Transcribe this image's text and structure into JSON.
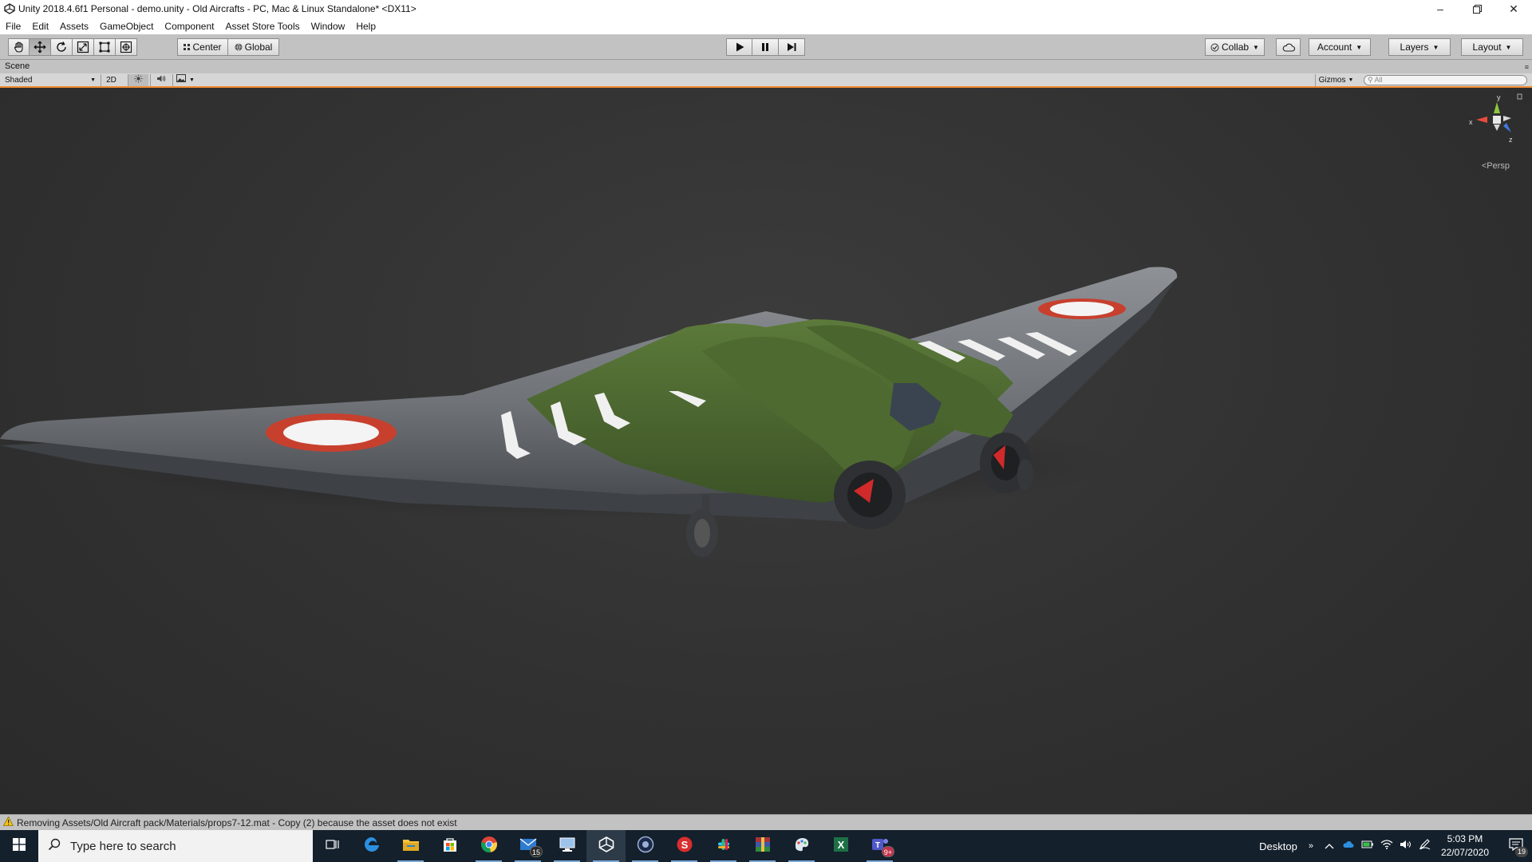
{
  "window": {
    "title": "Unity 2018.4.6f1 Personal - demo.unity - Old Aircrafts - PC, Mac & Linux Standalone* <DX11>"
  },
  "menu": [
    "File",
    "Edit",
    "Assets",
    "GameObject",
    "Component",
    "Asset Store Tools",
    "Window",
    "Help"
  ],
  "toolbar": {
    "transform_tools": [
      "hand-icon",
      "move-icon",
      "rotate-icon",
      "scale-icon",
      "rect-icon",
      "transform-icon"
    ],
    "active_tool": "move-icon",
    "pivot_mode": "Center",
    "pivot_rotation": "Global",
    "collab": "Collab",
    "account": "Account",
    "layers": "Layers",
    "layout": "Layout"
  },
  "scene": {
    "tab": "Scene",
    "draw_mode": "Shaded",
    "mode_2d": "2D",
    "gizmos": "Gizmos",
    "search_placeholder": "All",
    "projection": "Persp",
    "axis_x": "x",
    "axis_y": "y",
    "axis_z": "z"
  },
  "status": {
    "message": "Removing Assets/Old Aircraft pack/Materials/props7-12.mat - Copy (2) because the asset does not exist"
  },
  "taskbar": {
    "search_placeholder": "Type here to search",
    "apps": [
      {
        "name": "task-view-icon",
        "badge": ""
      },
      {
        "name": "edge-icon",
        "badge": ""
      },
      {
        "name": "file-explorer-icon",
        "badge": ""
      },
      {
        "name": "store-icon",
        "badge": ""
      },
      {
        "name": "chrome-icon",
        "badge": ""
      },
      {
        "name": "mail-icon",
        "badge": "15"
      },
      {
        "name": "remote-desktop-icon",
        "badge": ""
      },
      {
        "name": "unity-icon",
        "badge": ""
      },
      {
        "name": "cinema4d-icon",
        "badge": ""
      },
      {
        "name": "substance-icon",
        "badge": ""
      },
      {
        "name": "slack-icon",
        "badge": ""
      },
      {
        "name": "winrar-icon",
        "badge": ""
      },
      {
        "name": "paint-icon",
        "badge": ""
      },
      {
        "name": "excel-icon",
        "badge": ""
      },
      {
        "name": "teams-icon",
        "badge": "9+"
      }
    ],
    "desktop_label": "Desktop",
    "time": "5:03 PM",
    "date": "22/07/2020",
    "notifications": "19"
  },
  "colors": {
    "accent_orange": "#f08a33",
    "toolbar_gray": "#c2c2c2",
    "viewport_bg": "#313131",
    "taskbar_bg": "#14202c",
    "aircraft_green": "#4a6630",
    "aircraft_gray": "#7c8084"
  }
}
